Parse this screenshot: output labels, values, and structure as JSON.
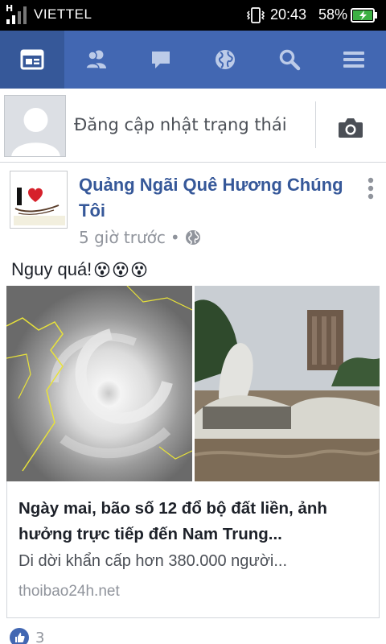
{
  "status_bar": {
    "carrier": "VIETTEL",
    "time": "20:43",
    "battery": "58%",
    "signal_label": "H",
    "icons": [
      "signal-icon",
      "vibrate-icon",
      "battery-charging-icon"
    ]
  },
  "nav": {
    "tabs": [
      {
        "name": "news-feed",
        "icon": "news-feed-icon",
        "active": true
      },
      {
        "name": "friend-requests",
        "icon": "friends-icon",
        "active": false
      },
      {
        "name": "messages",
        "icon": "chat-icon",
        "active": false
      },
      {
        "name": "notifications",
        "icon": "globe-icon",
        "active": false
      },
      {
        "name": "search",
        "icon": "search-icon",
        "active": false
      },
      {
        "name": "menu",
        "icon": "menu-icon",
        "active": false
      }
    ],
    "colors": {
      "bar": "#4267b2",
      "active": "#365899"
    }
  },
  "composer": {
    "prompt": "Đăng cập nhật trạng thái",
    "camera_icon": "camera-icon"
  },
  "post": {
    "page_name": "Quảng Ngãi Quê Hương Chúng Tôi",
    "time": "5 giờ trước",
    "separator": "•",
    "privacy_icon": "globe-icon",
    "text": "Nguy quá!",
    "emoji_count": 3,
    "link": {
      "title": "Ngày mai, bão số 12 đổ bộ đất liền, ảnh hưởng trực tiếp đến Nam Trung...",
      "description": "Di dời khẩn cấp hơn 380.000 người...",
      "domain": "thoibao24h.net"
    },
    "reactions": {
      "like_count": "3"
    }
  }
}
